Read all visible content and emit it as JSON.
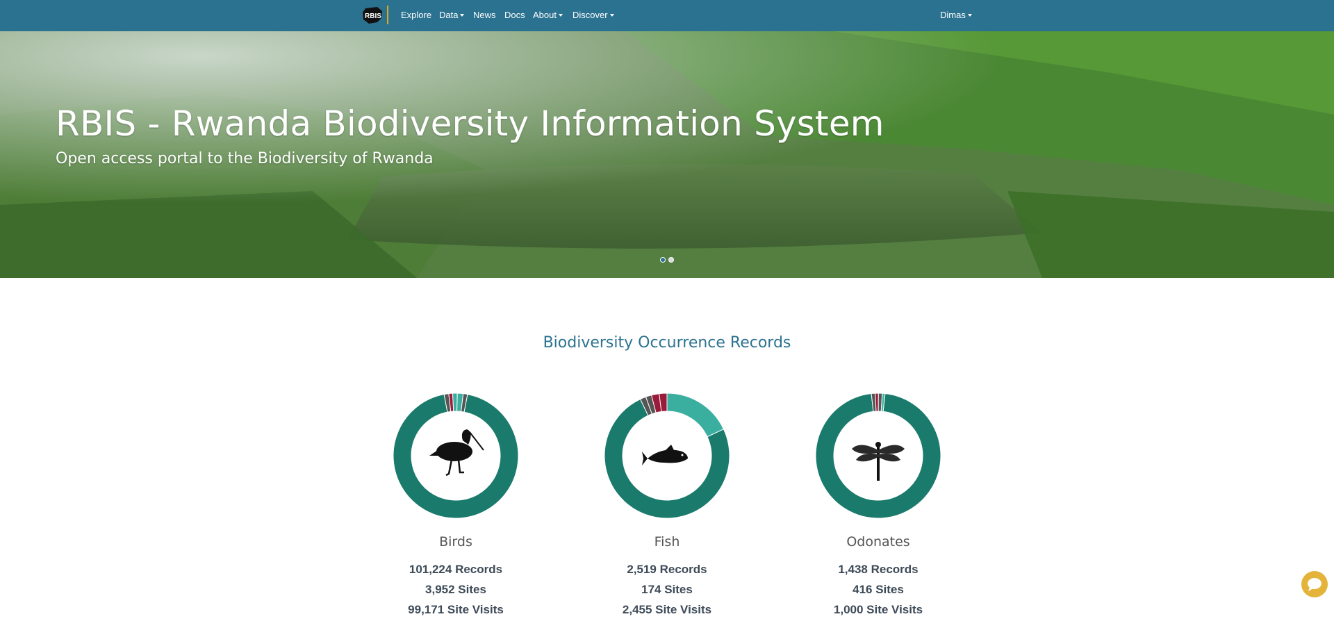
{
  "navbar": {
    "logo_text": "RBIS",
    "items": [
      {
        "label": "Explore",
        "dropdown": false
      },
      {
        "label": "Data",
        "dropdown": true
      },
      {
        "label": "News",
        "dropdown": false
      },
      {
        "label": "Docs",
        "dropdown": false
      },
      {
        "label": "About",
        "dropdown": true
      },
      {
        "label": "Discover",
        "dropdown": true
      }
    ],
    "user": "Dimas"
  },
  "hero": {
    "title": "RBIS - Rwanda Biodiversity Information System",
    "subtitle": "Open access portal to the Biodiversity of Rwanda",
    "slides": 2,
    "active_slide": 1
  },
  "section": {
    "title": "Biodiversity Occurrence Records"
  },
  "cards": [
    {
      "name": "Birds",
      "icon": "bird-icon",
      "records": "101,224 Records",
      "sites": "3,952 Sites",
      "visits": "99,171 Site Visits"
    },
    {
      "name": "Fish",
      "icon": "fish-icon",
      "records": "2,519 Records",
      "sites": "174 Sites",
      "visits": "2,455 Site Visits"
    },
    {
      "name": "Odonates",
      "icon": "dragonfly-icon",
      "records": "1,438 Records",
      "sites": "416 Sites",
      "visits": "1,000 Site Visits"
    }
  ],
  "chart_data": [
    {
      "type": "pie",
      "series_shares": [
        0.94,
        0.012,
        0.01,
        0.012,
        0.015,
        0.011
      ]
    },
    {
      "type": "pie",
      "series_shares": [
        0.75,
        0.18,
        0.02,
        0.02,
        0.015,
        0.015
      ]
    },
    {
      "type": "pie",
      "series_shares": [
        0.965,
        0.01,
        0.008,
        0.01,
        0.007
      ]
    }
  ],
  "colors": {
    "navbar": "#2b7290",
    "accent": "#e1a81e",
    "donut_main": "#1a7a6c",
    "donut_secondary": "#3aafa0",
    "donut_red": "#9b1b3a",
    "donut_gray": "#555555",
    "section_title": "#2b7290",
    "chat_button": "#e3b33a"
  }
}
